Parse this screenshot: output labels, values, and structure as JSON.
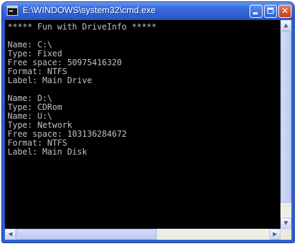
{
  "window": {
    "title": "E:\\WINDOWS\\system32\\cmd.exe",
    "buttons": {
      "minimize": "minimize",
      "maximize": "maximize",
      "close": "✕"
    }
  },
  "console": {
    "lines": [
      "***** Fun with DriveInfo *****",
      "",
      "Name: C:\\",
      "Type: Fixed",
      "Free space: 50975416320",
      "Format: NTFS",
      "Label: Main Drive",
      "",
      "Name: D:\\",
      "Type: CDRom",
      "Name: U:\\",
      "Type: Network",
      "Free space: 103136284672",
      "Format: NTFS",
      "Label: Main Disk"
    ]
  },
  "scrollbars": {
    "up_arrow": "▲",
    "down_arrow": "▼",
    "left_arrow": "◀",
    "right_arrow": "▶"
  },
  "colors": {
    "titlebar": "#2f5fd0",
    "console_bg": "#000000",
    "console_text": "#c0c0c0",
    "close_button": "#c53e1e"
  }
}
